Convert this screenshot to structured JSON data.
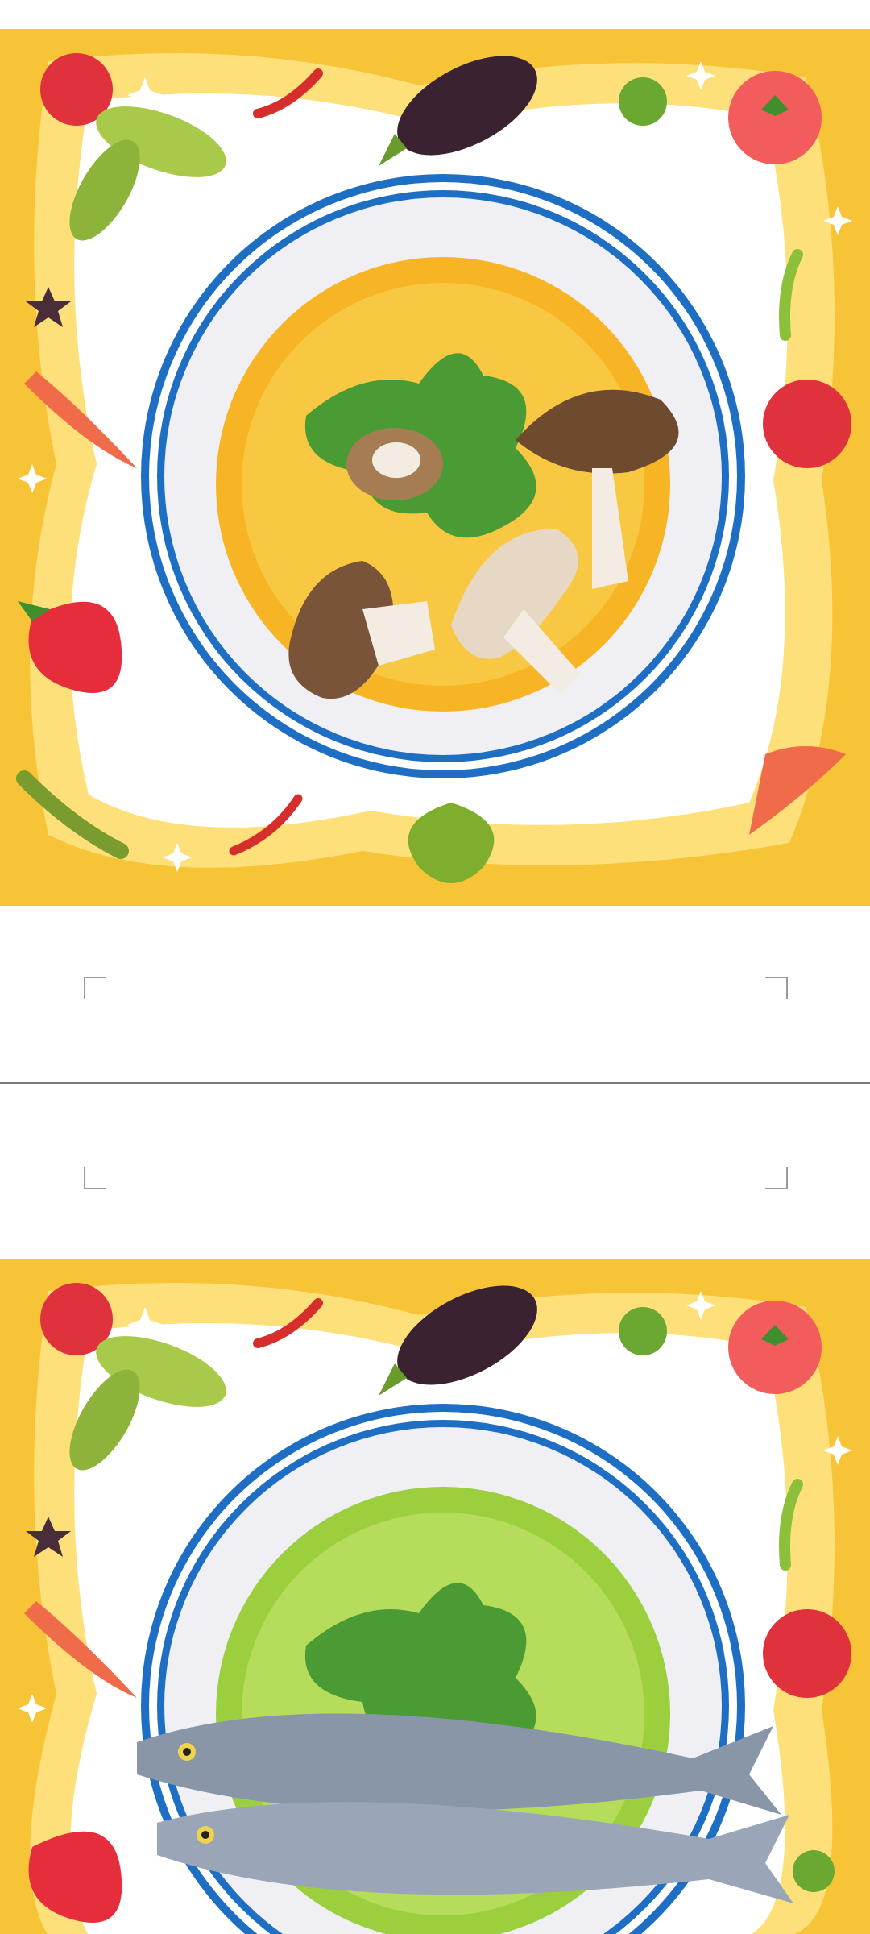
{
  "document": {
    "pages": [
      {
        "id": "page-1",
        "illustration": "mushroom-soup-plate",
        "soup_color": "#f7b526"
      },
      {
        "id": "page-2",
        "illustration": "fish-soup-plate",
        "soup_color": "#9bcf3e"
      }
    ],
    "frame_colors": {
      "border_yellow": "#f7c437",
      "border_light": "#fde07a",
      "plate_rim": "#1e6fc4",
      "plate_inner": "#f0f0f4"
    },
    "icons": [
      "crop-mark-icon",
      "tomato-icon",
      "eggplant-icon",
      "chili-icon",
      "carrot-icon",
      "strawberry-icon",
      "mushroom-icon",
      "fish-icon"
    ]
  }
}
